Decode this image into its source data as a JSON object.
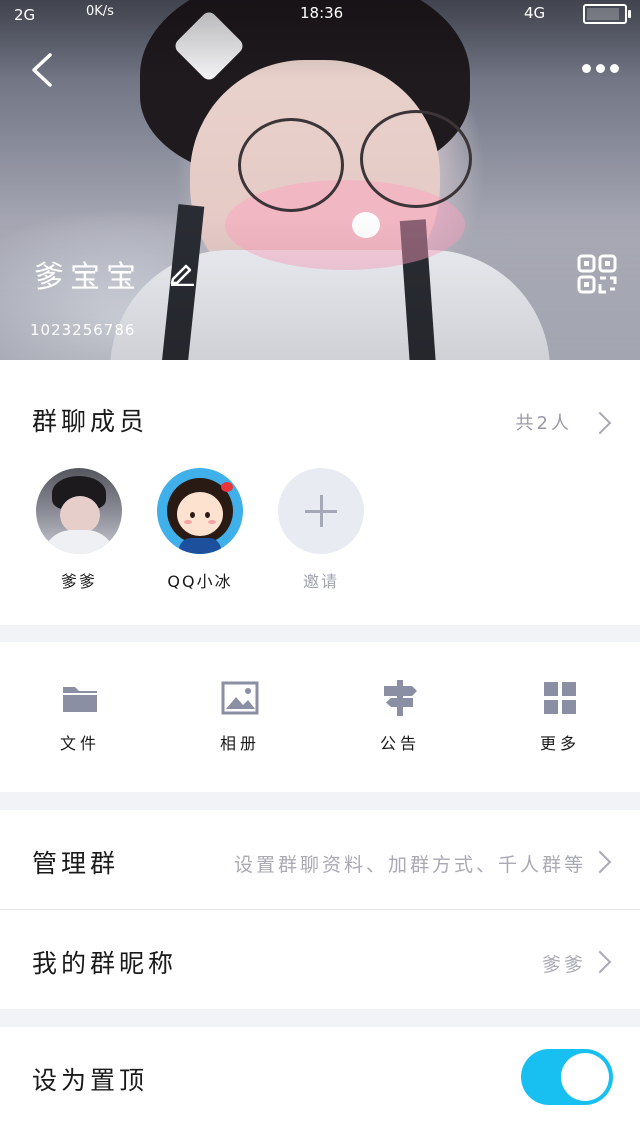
{
  "status_bar": {
    "network": "2G",
    "speed": "0K/s",
    "time": "18:36",
    "network_right": "4G"
  },
  "header": {
    "group_name": "爹宝宝",
    "group_id": "1023256786",
    "icons": [
      "back-icon",
      "more-icon",
      "edit-icon",
      "qr-code-icon"
    ]
  },
  "members": {
    "title": "群聊成员",
    "count": "共2人",
    "items": [
      {
        "name": "爹爹"
      },
      {
        "name": "QQ小冰"
      },
      {
        "name": "邀请"
      }
    ]
  },
  "tools": [
    {
      "label": "文件",
      "icon": "folder-icon"
    },
    {
      "label": "相册",
      "icon": "photo-icon"
    },
    {
      "label": "公告",
      "icon": "signpost-icon"
    },
    {
      "label": "更多",
      "icon": "grid-icon"
    }
  ],
  "settings": {
    "manage": {
      "label": "管理群",
      "value": "设置群聊资料、加群方式、千人群等"
    },
    "nickname": {
      "label": "我的群昵称",
      "value": "爹爹"
    },
    "pin": {
      "label": "设为置顶",
      "on": true
    }
  },
  "colors": {
    "accent": "#18c0f2",
    "muted_text": "#a9aab4",
    "icon_gray": "#8a8fa3"
  }
}
